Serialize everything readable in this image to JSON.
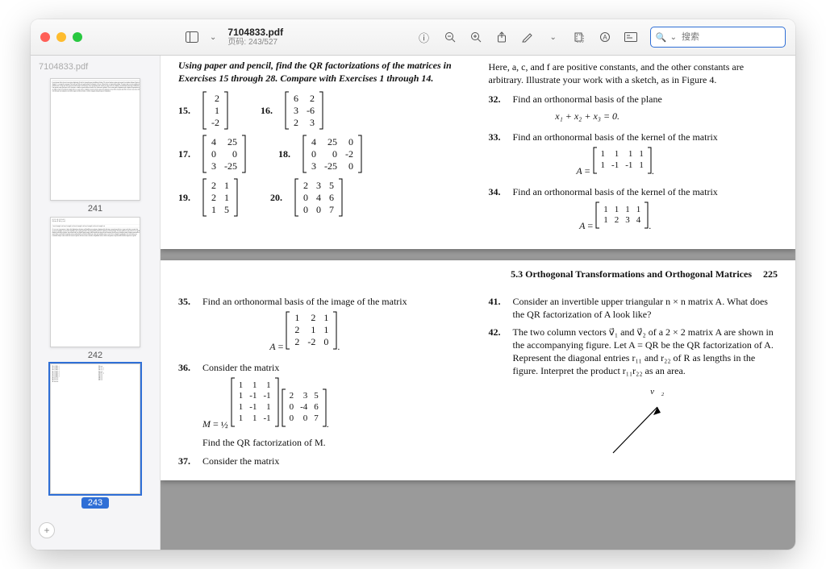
{
  "window": {
    "title": "7104833.pdf",
    "subtitle": "页码: 243/527",
    "search_placeholder": "搜索"
  },
  "sidebar": {
    "doc_label": "7104833.pdf",
    "pages": [
      "241",
      "242",
      "243"
    ],
    "current": "243"
  },
  "upper": {
    "instructions": "Using paper and pencil, find the QR factorizations of the matrices in Exercises 15 through 28. Compare with Exercises 1 through 14.",
    "right_intro": "Here, a, c, and f are positive constants, and the other constants are arbitrary. Illustrate your work with a sketch, as in Figure 4.",
    "p32_n": "32.",
    "p32": "Find an orthonormal basis of the plane",
    "p32_eq": "x₁ + x₂ + x₃ = 0.",
    "p33_n": "33.",
    "p33": "Find an orthonormal basis of the kernel of the matrix",
    "p34_n": "34.",
    "p34": "Find an orthonormal basis of the kernel of the matrix",
    "ex15_n": "15.",
    "ex16_n": "16.",
    "ex17_n": "17.",
    "ex18_n": "18.",
    "ex19_n": "19.",
    "ex20_n": "20."
  },
  "lower": {
    "section": "5.3  Orthogonal Transformations and Orthogonal Matrices",
    "pagenum": "225",
    "p35_n": "35.",
    "p35": "Find an orthonormal basis of the image of the matrix",
    "p36_n": "36.",
    "p36": "Consider the matrix",
    "p36_after": "Find the QR factorization of M.",
    "p37_n": "37.",
    "p37": "Consider the matrix",
    "p41_n": "41.",
    "p41": "Consider an invertible upper triangular n × n matrix A. What does the QR factorization of A look like?",
    "p42_n": "42.",
    "p42": "The two column vectors v⃗₁ and v⃗₂ of a 2 × 2 matrix A are shown in the accompanying figure. Let A = QR be the QR factorization of A. Represent the diagonal entries r₁₁ and r₂₂ of R as lengths in the figure. Interpret the product r₁₁r₂₂ as an area.",
    "v2_label": "v⃗₂"
  },
  "matrices": {
    "m15": [
      [
        "2"
      ],
      [
        "1"
      ],
      [
        "-2"
      ]
    ],
    "m16": [
      [
        "6",
        "2"
      ],
      [
        "3",
        "-6"
      ],
      [
        "2",
        "3"
      ]
    ],
    "m17": [
      [
        "4",
        "25"
      ],
      [
        "0",
        "0"
      ],
      [
        "3",
        "-25"
      ]
    ],
    "m18": [
      [
        "4",
        "25",
        "0"
      ],
      [
        "0",
        "0",
        "-2"
      ],
      [
        "3",
        "-25",
        "0"
      ]
    ],
    "m19": [
      [
        "2",
        "1"
      ],
      [
        "2",
        "1"
      ],
      [
        "1",
        "5"
      ]
    ],
    "m20": [
      [
        "2",
        "3",
        "5"
      ],
      [
        "0",
        "4",
        "6"
      ],
      [
        "0",
        "0",
        "7"
      ]
    ],
    "m33": [
      [
        "1",
        "1",
        "1",
        "1"
      ],
      [
        "1",
        "-1",
        "-1",
        "1"
      ]
    ],
    "m34": [
      [
        "1",
        "1",
        "1",
        "1"
      ],
      [
        "1",
        "2",
        "3",
        "4"
      ]
    ],
    "m35": [
      [
        "1",
        "2",
        "1"
      ],
      [
        "2",
        "1",
        "1"
      ],
      [
        "2",
        "-2",
        "0"
      ]
    ],
    "m36a": [
      [
        "1",
        "1",
        "1"
      ],
      [
        "1",
        "-1",
        "-1"
      ],
      [
        "1",
        "-1",
        "1"
      ],
      [
        "1",
        "1",
        "-1"
      ]
    ],
    "m36b": [
      [
        "2",
        "3",
        "5"
      ],
      [
        "0",
        "-4",
        "6"
      ],
      [
        "0",
        "0",
        "7"
      ]
    ]
  }
}
